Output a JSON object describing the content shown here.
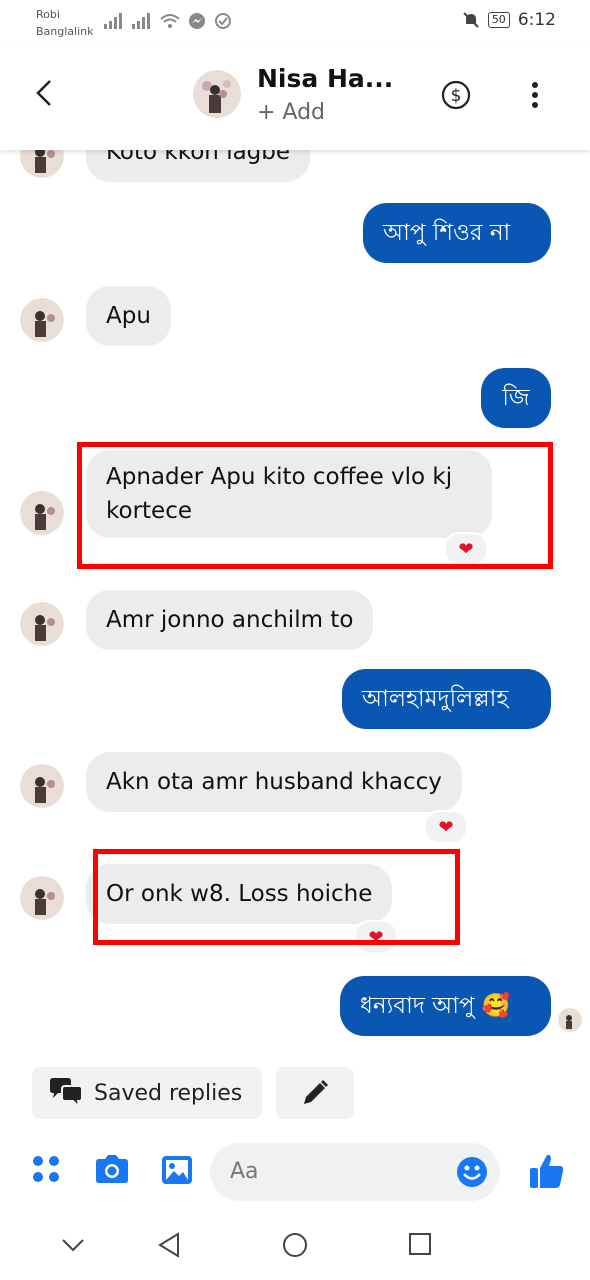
{
  "status_bar": {
    "carrier_line1": "Robi",
    "carrier_line2": "Banglalink",
    "battery": "50",
    "time": "6:12"
  },
  "header": {
    "contact_name": "Nisa Ha...",
    "add_label": "+ Add",
    "icons": [
      "back-arrow-icon",
      "dollar-icon",
      "more-vertical-icon"
    ]
  },
  "messages": [
    {
      "from": "them",
      "text": "Koto kkon lagbe"
    },
    {
      "from": "me",
      "text": "আপু শিওর না"
    },
    {
      "from": "them",
      "text": "Apu"
    },
    {
      "from": "me",
      "text": "জি"
    },
    {
      "from": "them",
      "text_line1": "Apnader Apu kito coffee vlo kj",
      "text_line2": "kortece",
      "reaction": "❤",
      "highlighted": true
    },
    {
      "from": "them",
      "text": "Amr jonno anchilm to"
    },
    {
      "from": "me",
      "text": "আলহামদুলিল্লাহ"
    },
    {
      "from": "them",
      "text": "Akn ota amr husband khaccy",
      "reaction": "❤"
    },
    {
      "from": "them",
      "text": "Or onk w8. Loss hoiche",
      "reaction": "❤",
      "highlighted": true
    },
    {
      "from": "me",
      "text": "ধন্যবাদ আপু 🥰"
    }
  ],
  "quick_actions": {
    "saved_replies_label": "Saved replies"
  },
  "composer": {
    "placeholder": "Aa"
  },
  "colors": {
    "outgoing_bubble": "#0a57b3",
    "incoming_bubble": "#ececec",
    "accent": "#1877f2",
    "highlight_box": "#ff0000",
    "reaction": "#e0132d"
  }
}
